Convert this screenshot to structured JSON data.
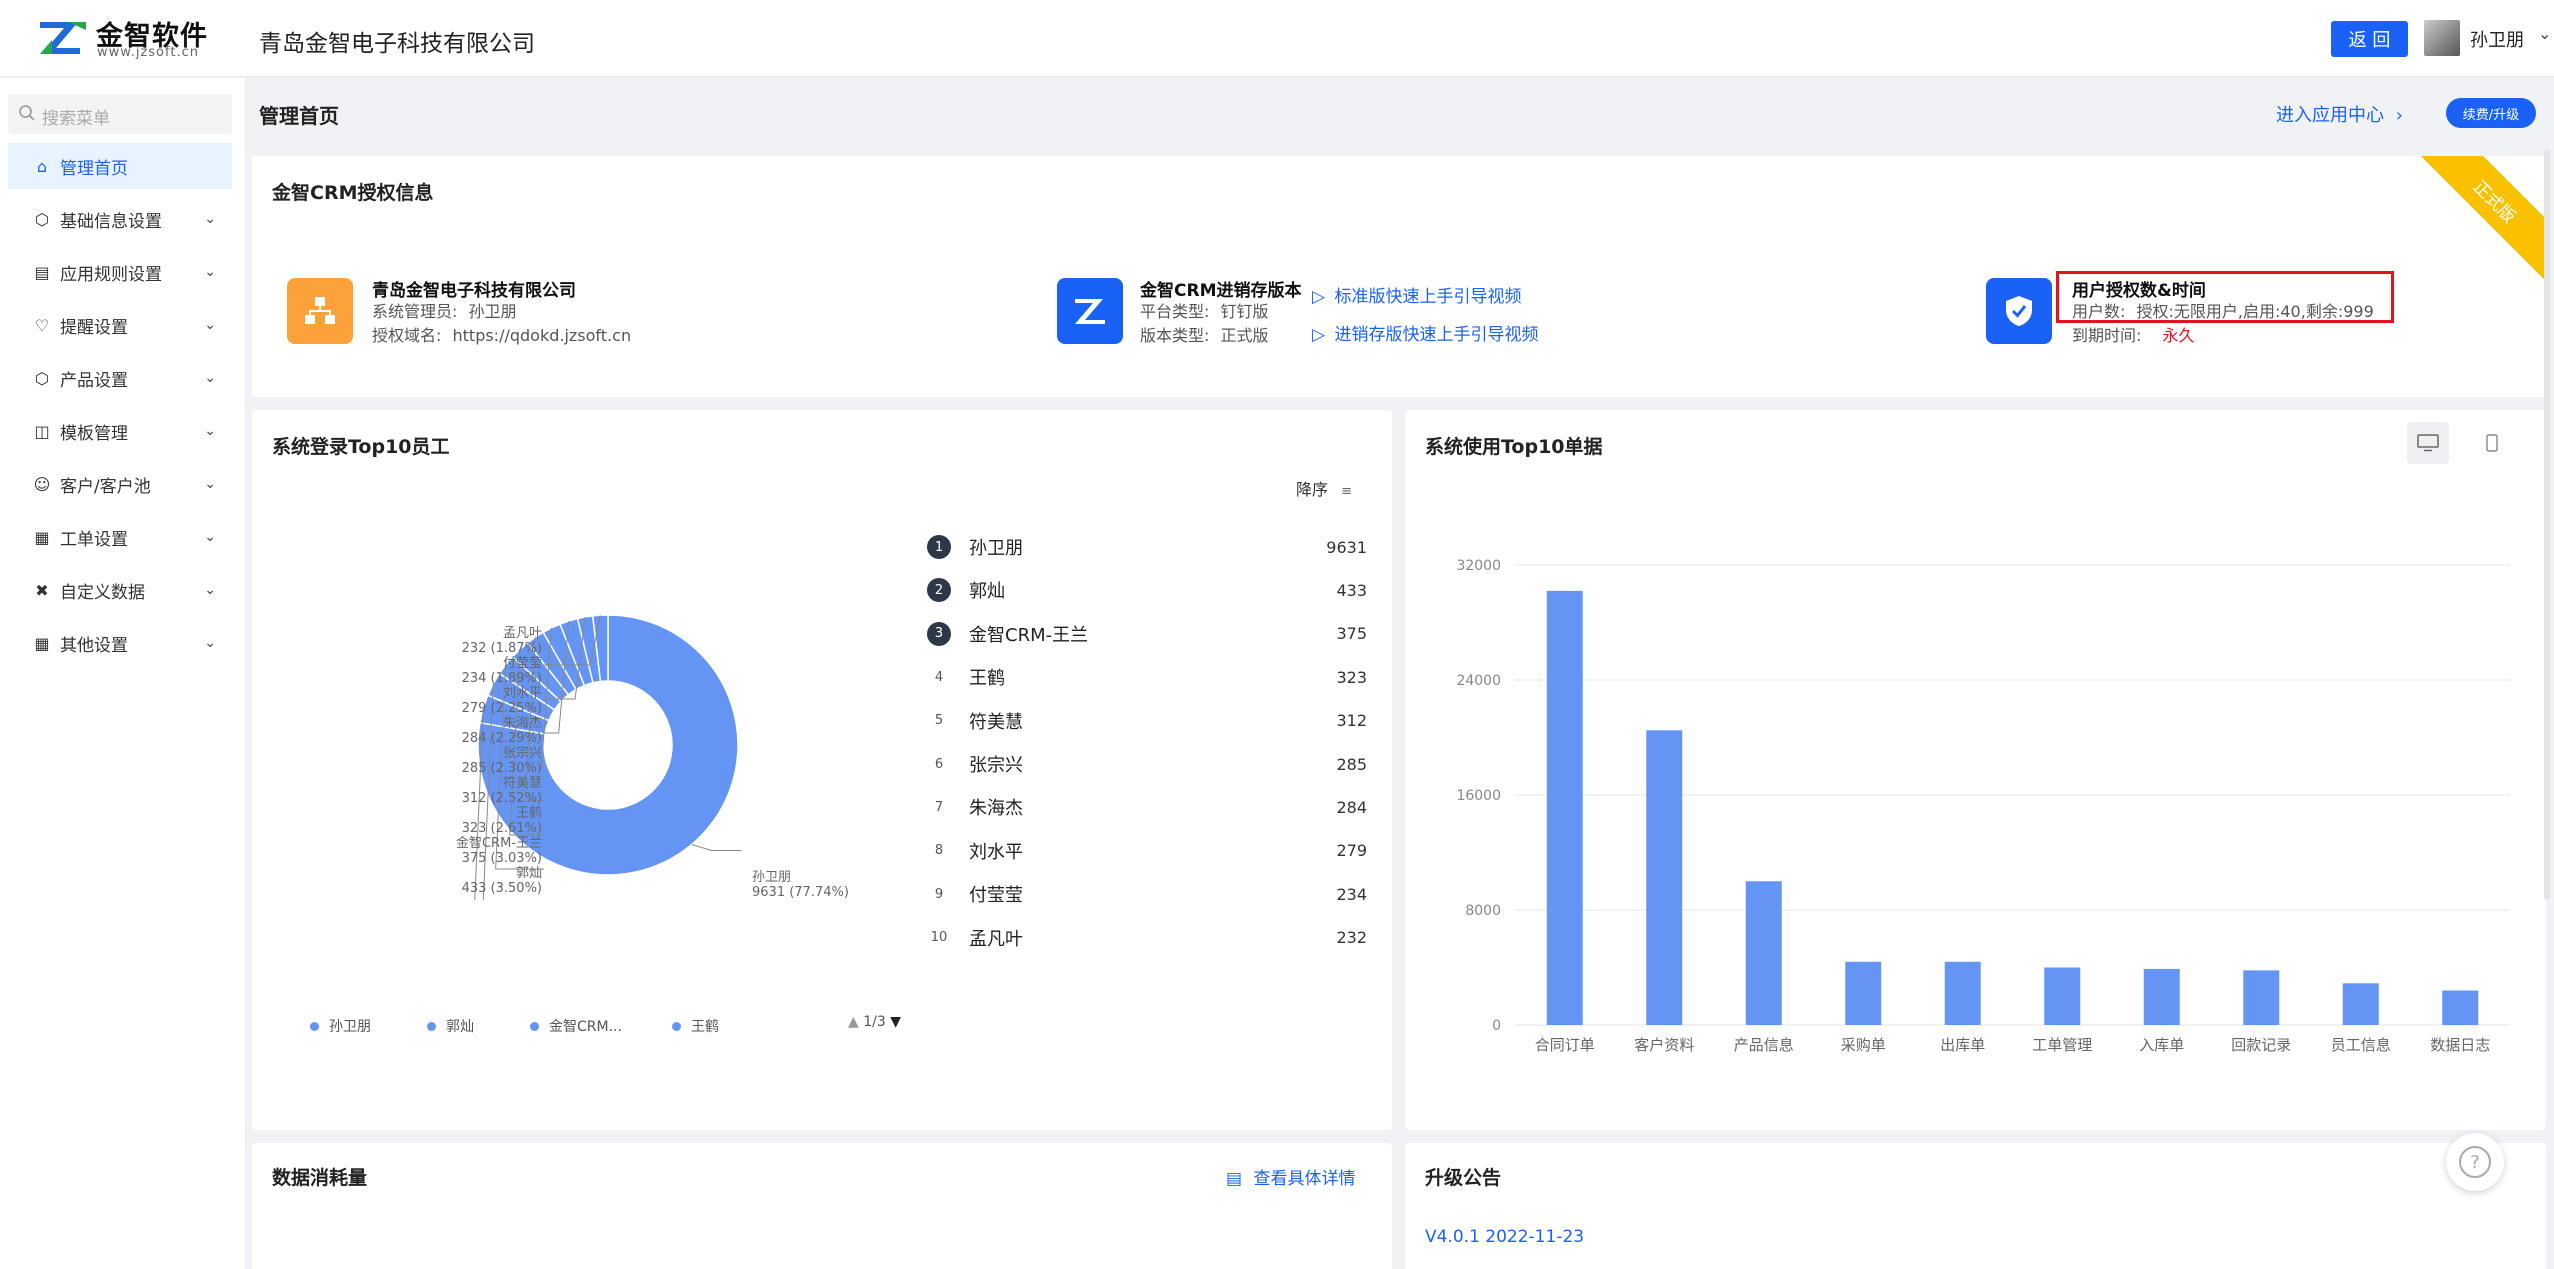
{
  "header": {
    "logo_title": "金智软件",
    "logo_sub": "www.jzsoft.cn",
    "company": "青岛金智电子科技有限公司",
    "back_label": "返 回",
    "username": "孙卫朋"
  },
  "sidebar": {
    "search_placeholder": "搜索菜单",
    "items": [
      {
        "label": "管理首页",
        "icon": "home-icon"
      },
      {
        "label": "基础信息设置",
        "icon": "cube-icon"
      },
      {
        "label": "应用规则设置",
        "icon": "doc-icon"
      },
      {
        "label": "提醒设置",
        "icon": "bell-icon"
      },
      {
        "label": "产品设置",
        "icon": "box-icon"
      },
      {
        "label": "模板管理",
        "icon": "template-icon"
      },
      {
        "label": "客户/客户池",
        "icon": "user-icon"
      },
      {
        "label": "工单设置",
        "icon": "ticket-icon"
      },
      {
        "label": "自定义数据",
        "icon": "tools-icon"
      },
      {
        "label": "其他设置",
        "icon": "grid-icon"
      }
    ]
  },
  "page": {
    "title": "管理首页",
    "enter_app": "进入应用中心",
    "renew": "续费/升级"
  },
  "license": {
    "title": "金智CRM授权信息",
    "ribbon": "正式版",
    "company": {
      "name": "青岛金智电子科技有限公司",
      "admin_label": "系统管理员:",
      "admin": "孙卫朋",
      "domain_label": "授权域名:",
      "domain": "https://qdokd.jzsoft.cn"
    },
    "version": {
      "name": "金智CRM进销存版本",
      "platform_label": "平台类型:",
      "platform": "钉钉版",
      "type_label": "版本类型:",
      "type": "正式版",
      "video1": "标准版快速上手引导视频",
      "video2": "进销存版快速上手引导视频"
    },
    "auth": {
      "title": "用户授权数&时间",
      "users_label": "用户数:",
      "users": "授权:无限用户,启用:40,剩余:999",
      "expire_label": "到期时间:",
      "expire": "永久"
    }
  },
  "login_top10": {
    "title": "系统登录Top10员工",
    "sort_label": "降序",
    "ranking": [
      {
        "rank": "1",
        "name": "孙卫朋",
        "value": "9631"
      },
      {
        "rank": "2",
        "name": "郭灿",
        "value": "433"
      },
      {
        "rank": "3",
        "name": "金智CRM-王兰",
        "value": "375"
      },
      {
        "rank": "4",
        "name": "王鹤",
        "value": "323"
      },
      {
        "rank": "5",
        "name": "符美慧",
        "value": "312"
      },
      {
        "rank": "6",
        "name": "张宗兴",
        "value": "285"
      },
      {
        "rank": "7",
        "name": "朱海杰",
        "value": "284"
      },
      {
        "rank": "8",
        "name": "刘水平",
        "value": "279"
      },
      {
        "rank": "9",
        "name": "付莹莹",
        "value": "234"
      },
      {
        "rank": "10",
        "name": "孟凡叶",
        "value": "232"
      }
    ],
    "pie_labels": [
      {
        "name": "孟凡叶",
        "detail": "232 (1.87%)"
      },
      {
        "name": "付莹莹",
        "detail": "234 (1.89%)"
      },
      {
        "name": "刘水平",
        "detail": "279 (2.25%)"
      },
      {
        "name": "朱海杰",
        "detail": "284 (2.29%)"
      },
      {
        "name": "张宗兴",
        "detail": "285 (2.30%)"
      },
      {
        "name": "符美慧",
        "detail": "312 (2.52%)"
      },
      {
        "name": "王鹤",
        "detail": "323 (2.61%)"
      },
      {
        "name": "金智CRM-王兰",
        "detail": "375 (3.03%)"
      },
      {
        "name": "郭灿",
        "detail": "433 (3.50%)"
      }
    ],
    "main_label": {
      "name": "孙卫朋",
      "detail": "9631 (77.74%)"
    },
    "legend": [
      "孙卫朋",
      "郭灿",
      "金智CRM...",
      "王鹤"
    ],
    "legend_page": "1/3"
  },
  "chart_data": {
    "type": "bar",
    "title": "系统使用Top10单据",
    "categories": [
      "合同订单",
      "客户资料",
      "产品信息",
      "采购单",
      "出库单",
      "工单管理",
      "入库单",
      "回款记录",
      "员工信息",
      "数据日志"
    ],
    "values": [
      30200,
      20500,
      10000,
      4400,
      4400,
      4000,
      3900,
      3800,
      2900,
      2400
    ],
    "y_ticks": [
      "0",
      "8000",
      "16000",
      "24000",
      "32000"
    ],
    "ylim": [
      0,
      32000
    ],
    "color": "#6495f5",
    "grid": true
  },
  "data_usage": {
    "title": "数据消耗量",
    "detail_link": "查看具体详情"
  },
  "notice": {
    "title": "升级公告",
    "version": "V4.0.1 2022-11-23"
  },
  "colors": {
    "primary": "#1a62f5",
    "ribbon": "#f9c100",
    "highlight": "#e5121b"
  }
}
